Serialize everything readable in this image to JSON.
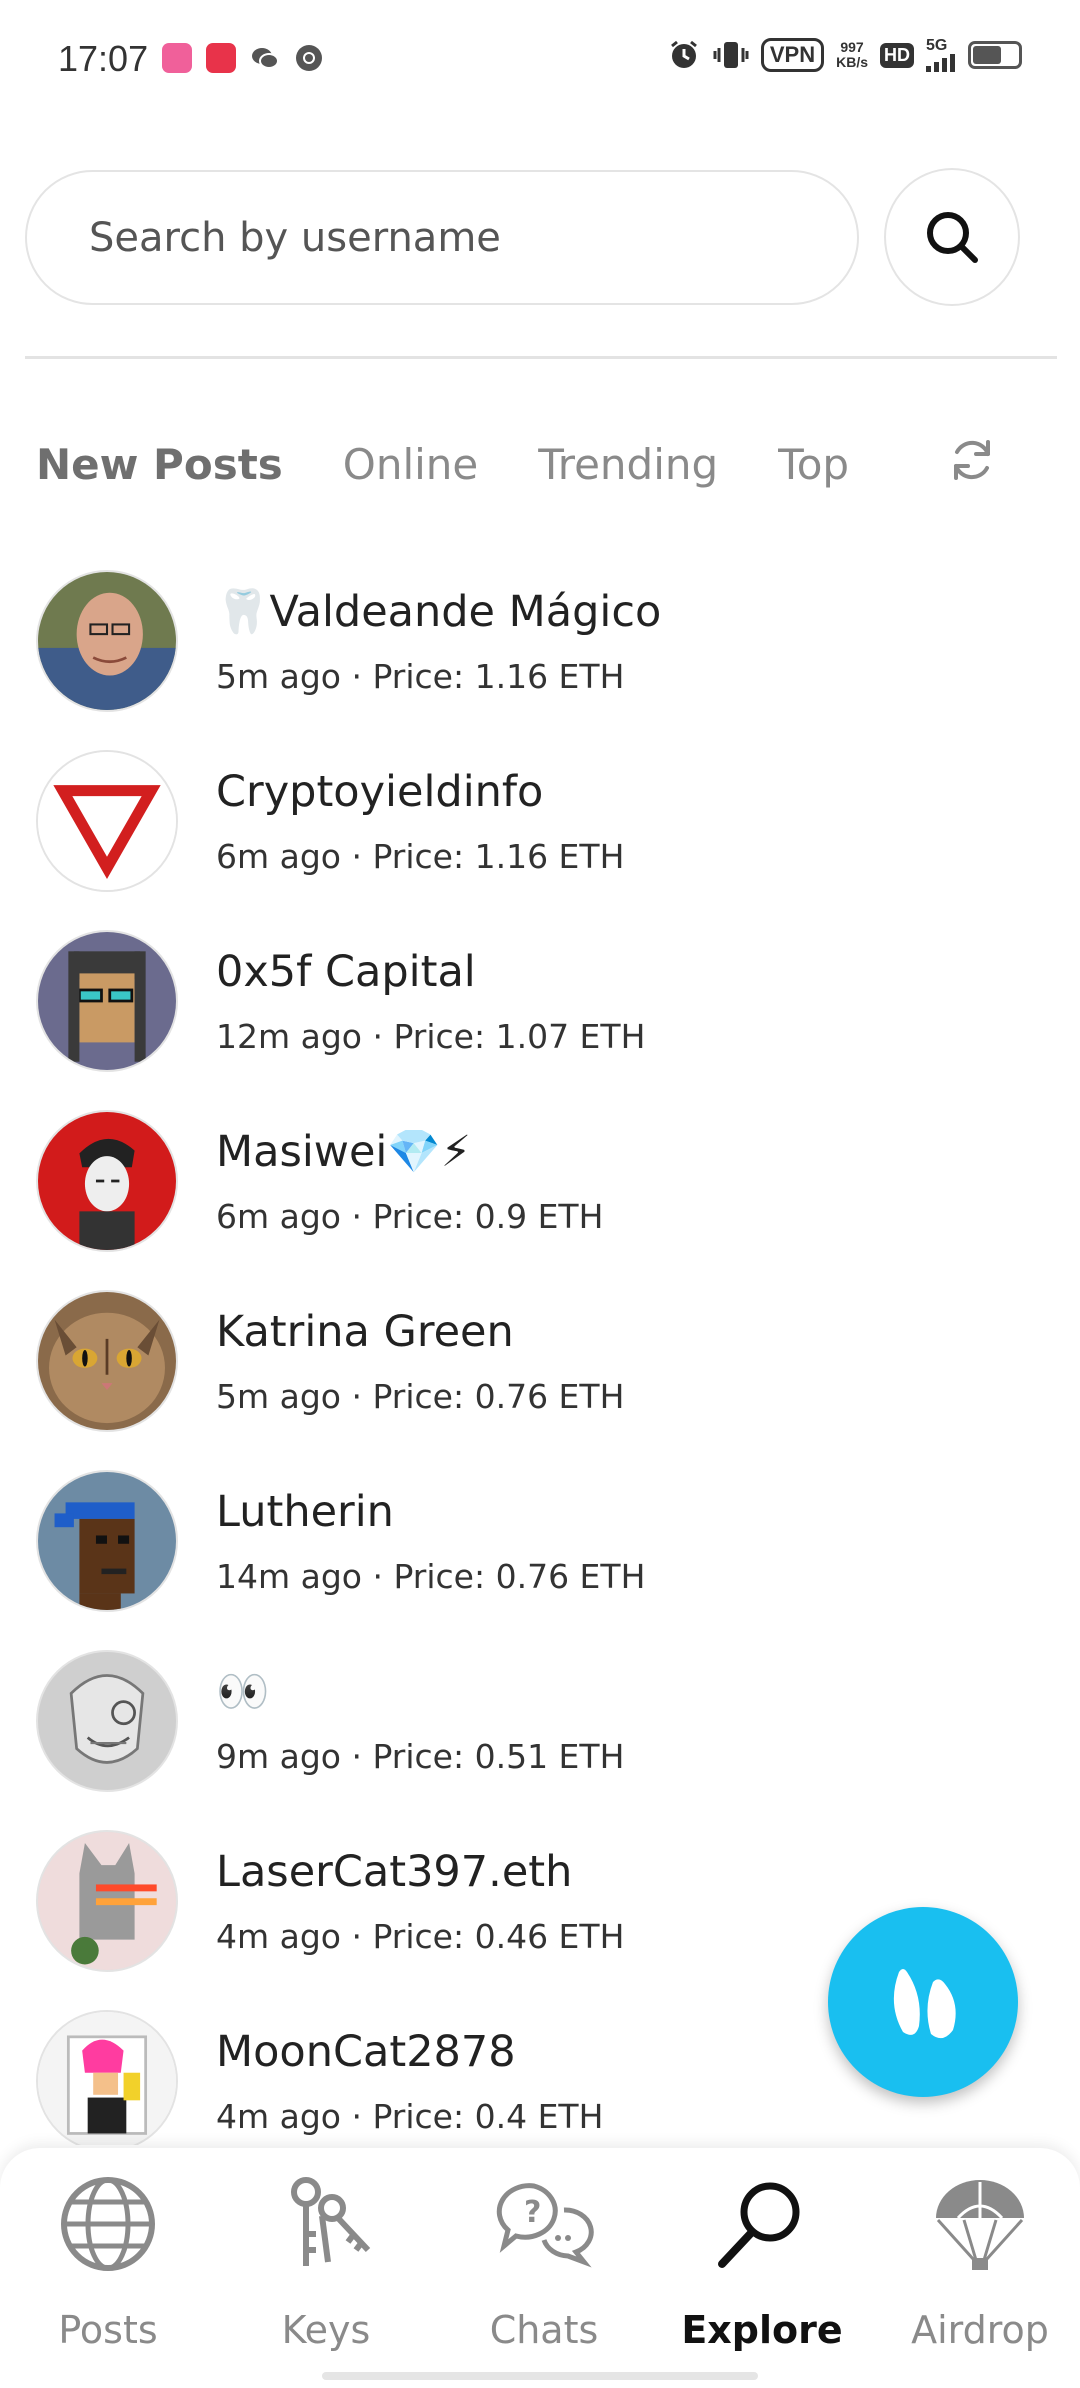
{
  "status_bar": {
    "time": "17:07",
    "notification_icons": [
      "lofter-app-icon",
      "xiaohongshu-app-icon",
      "wechat-icon",
      "chrome-icon"
    ],
    "vpn_label": "VPN",
    "net_speed_value": "997",
    "net_speed_unit": "KB/s",
    "hd_label": "HD",
    "network_label": "5G",
    "battery_level": 0.64
  },
  "search": {
    "placeholder": "Search by username"
  },
  "tabs": [
    {
      "label": "New Posts",
      "active": true
    },
    {
      "label": "Online",
      "active": false
    },
    {
      "label": "Trending",
      "active": false
    },
    {
      "label": "Top",
      "active": false
    }
  ],
  "posts": [
    {
      "name": "🦷Valdeande Mágico",
      "time": "5m ago",
      "price": "Price: 1.16 ETH"
    },
    {
      "name": "Cryptoyieldinfo",
      "time": "6m ago",
      "price": "Price: 1.16 ETH"
    },
    {
      "name": "0x5f Capital",
      "time": "12m ago",
      "price": "Price: 1.07 ETH"
    },
    {
      "name": "Masiwei💎⚡",
      "time": "6m ago",
      "price": "Price: 0.9 ETH"
    },
    {
      "name": "Katrina Green",
      "time": "5m ago",
      "price": "Price: 0.76 ETH"
    },
    {
      "name": "Lutherin",
      "time": "14m ago",
      "price": "Price: 0.76 ETH"
    },
    {
      "name": "👀",
      "time": "9m ago",
      "price": "Price: 0.51 ETH"
    },
    {
      "name": "LaserCat397.eth",
      "time": "4m ago",
      "price": "Price: 0.46 ETH"
    },
    {
      "name": "MoonCat2878",
      "time": "4m ago",
      "price": "Price: 0.4 ETH"
    }
  ],
  "meta_separator": " · ",
  "bottom_nav": [
    {
      "label": "Posts",
      "icon": "globe-icon",
      "active": false
    },
    {
      "label": "Keys",
      "icon": "keys-icon",
      "active": false
    },
    {
      "label": "Chats",
      "icon": "chat-bubbles-icon",
      "active": false
    },
    {
      "label": "Explore",
      "icon": "magnifier-icon",
      "active": true
    },
    {
      "label": "Airdrop",
      "icon": "parachute-icon",
      "active": false
    }
  ],
  "colors": {
    "fab": "#19bff0",
    "tab_inactive": "#8a8a8a",
    "tab_active": "#6f6f6f",
    "nav_active": "#111111",
    "nav_inactive": "#8a8a8a"
  }
}
